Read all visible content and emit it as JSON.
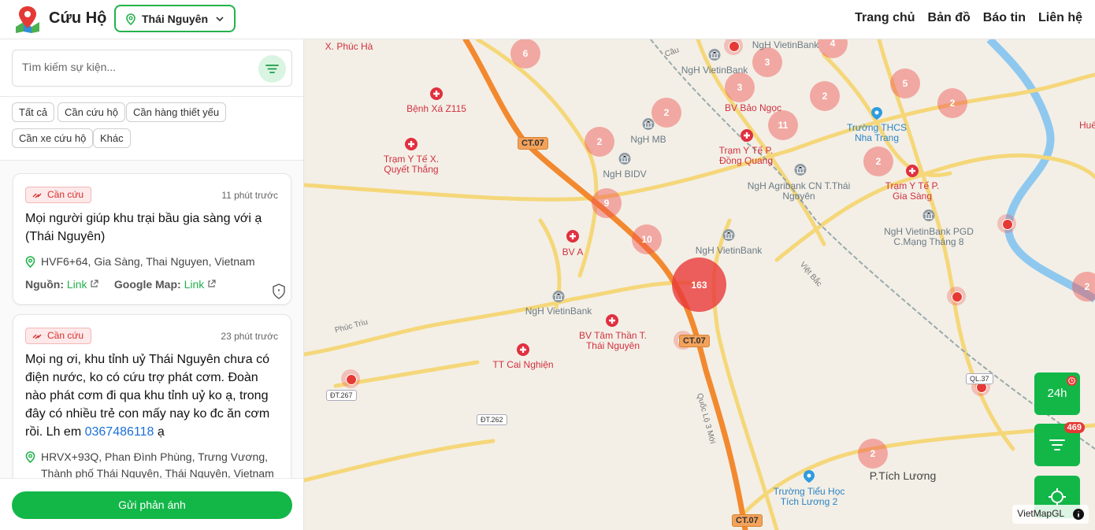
{
  "header": {
    "app_title": "Cứu Hộ",
    "location": "Thái Nguyên",
    "nav": [
      "Trang chủ",
      "Bản đồ",
      "Báo tin",
      "Liên hệ"
    ]
  },
  "sidebar": {
    "search_placeholder": "Tìm kiếm sự kiện...",
    "filters": [
      "Tất cả",
      "Cần cứu hộ",
      "Cần hàng thiết yếu",
      "Cần xe cứu hộ",
      "Khác"
    ],
    "cards": [
      {
        "badge": "Cần cứu",
        "time": "11 phút trước",
        "title": "Mọi người giúp khu trại bầu gia sàng với ạ (Thái Nguyên)",
        "address": "HVF6+64, Gia Sàng, Thai Nguyen, Vietnam",
        "source_label": "Nguồn:",
        "source_link": "Link",
        "map_label": "Google Map:",
        "map_link": "Link"
      },
      {
        "badge": "Cần cứu",
        "time": "23 phút trước",
        "title_pre": "Mọi ng ơi, khu tỉnh uỷ Thái Nguyên chưa có điện nước, ko có cứu trợ phát cơm. Đoàn nào phát cơm đi qua khu tỉnh uỷ ko ạ, trong đây có nhiều trẻ con mấy nay ko đc ăn cơm rồi. Lh em",
        "phone": "0367486118",
        "title_post": "ạ",
        "address": "HRVX+93Q, Phan Đình Phùng, Trưng Vương, Thành phố Thái Nguyên, Thái Nguyên, Vietnam"
      }
    ],
    "submit_label": "Gửi phản ánh"
  },
  "map": {
    "clusters": [
      "6",
      "4",
      "3",
      "3",
      "5",
      "2",
      "2",
      "2",
      "11",
      "2",
      "2",
      "9",
      "10",
      "163",
      "2",
      "2"
    ],
    "labels": {
      "phuc_ha": "X. Phúc Hà",
      "benh_xa": "Bệnh Xá Z115",
      "ngh_vietin_top": "NgH VietinBank",
      "ngh_vietin_2": "NgH VietinBank",
      "bv_bao_ngoc": "BV Bảo Ngọc",
      "truong_thcs": "Trường THCS Nha Trang",
      "ngh_mb": "NgH MB",
      "tram_dong_quang": "Trạm Y Tế P. Đồng Quang",
      "tram_quyet_thang": "Trạm Y Tế X. Quyết Thắng",
      "ngh_bidv": "NgH BIDV",
      "ngh_agribank": "NgH Agribank CN T.Thái Nguyên",
      "tram_gia_sang": "Trạm Y Tế P. Gia Sàng",
      "ngh_pgd": "NgH VietinBank PGD C.Mạng Tháng 8",
      "bv_a": "BV A",
      "ngh_vietin_3": "NgH VietinBank",
      "ngh_vietin_4": "NgH VietinBank",
      "bv_tam_than": "BV Tâm Thần T. Thái Nguyên",
      "tt_cai_nghien": "TT Cai Nghiện",
      "tich_luong": "P.Tích Lương",
      "truong_tieu_hoc": "Trường Tiểu Học Tích Lương 2",
      "phuc_triu": "Phúc Trìu",
      "viet_bac": "Việt Bắc",
      "quoc_lo": "Quốc Lộ 3 Mới",
      "cau": "Cầu",
      "hue": "Huế"
    },
    "shields": [
      "CT.07",
      "CT.07",
      "CT.07",
      "ĐT.267",
      "ĐT.262",
      "QL.37"
    ],
    "button_24h": "24h",
    "filter_count": "469",
    "attribution": "VietMapGL"
  }
}
